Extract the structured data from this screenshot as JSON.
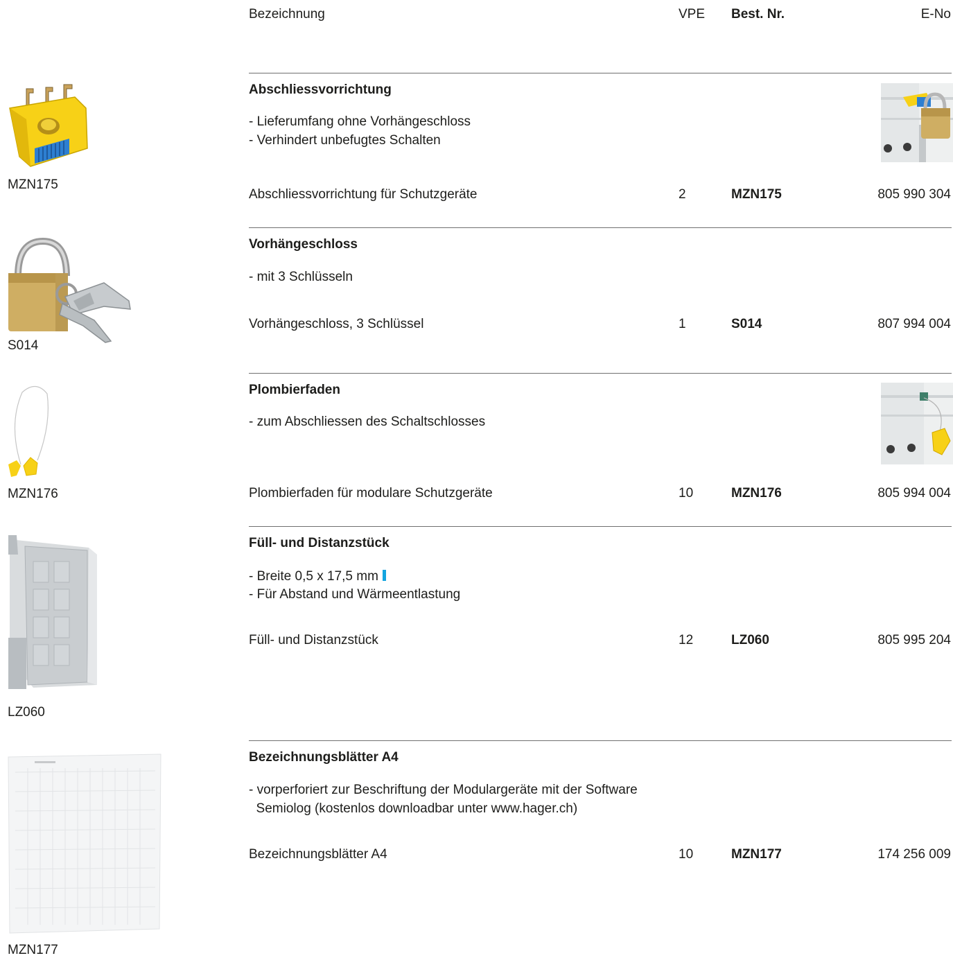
{
  "header": {
    "designation": "Bezeichnung",
    "vpe": "VPE",
    "order_no": "Best. Nr.",
    "e_no": "E-No"
  },
  "products": [
    {
      "caption": "MZN175",
      "title": "Abschliessvorrichtung",
      "features": [
        "- Lieferumfang ohne Vorhängeschloss",
        "- Verhindert unbefugtes Schalten"
      ],
      "name": "Abschliessvorrichtung für Schutzgeräte",
      "vpe": "2",
      "order_no": "MZN175",
      "e_no": "805 990 304"
    },
    {
      "caption": "S014",
      "title": "Vorhängeschloss",
      "features": [
        "- mit 3 Schlüsseln"
      ],
      "name": "Vorhängeschloss, 3 Schlüssel",
      "vpe": "1",
      "order_no": "S014",
      "e_no": "807 994 004"
    },
    {
      "caption": "MZN176",
      "title": "Plombierfaden",
      "features": [
        "- zum Abschliessen des Schaltschlosses"
      ],
      "name": "Plombierfaden für modulare Schutzgeräte",
      "vpe": "10",
      "order_no": "MZN176",
      "e_no": "805 994 004"
    },
    {
      "caption": "LZ060",
      "title": "Füll- und Distanzstück",
      "features": [
        "- Breite 0,5 x 17,5 mm",
        "- Für Abstand und Wärmeentlastung"
      ],
      "name": "Füll- und Distanzstück",
      "vpe": "12",
      "order_no": "LZ060",
      "e_no": "805 995 204"
    },
    {
      "caption": "MZN177",
      "title": "Bezeichnungsblätter A4",
      "features": [
        "- vorperforiert zur Beschriftung der Modulargeräte mit der Software",
        "  Semiolog (kostenlos downloadbar unter www.hager.ch)"
      ],
      "name": "Bezeichnungsblätter A4",
      "vpe": "10",
      "order_no": "MZN177",
      "e_no": "174 256 009"
    }
  ],
  "colors": {
    "text": "#1d1d1b",
    "rule": "#6f6f6f",
    "accent_blue": "#14a5e0",
    "lock_yellow": "#f7d117"
  }
}
